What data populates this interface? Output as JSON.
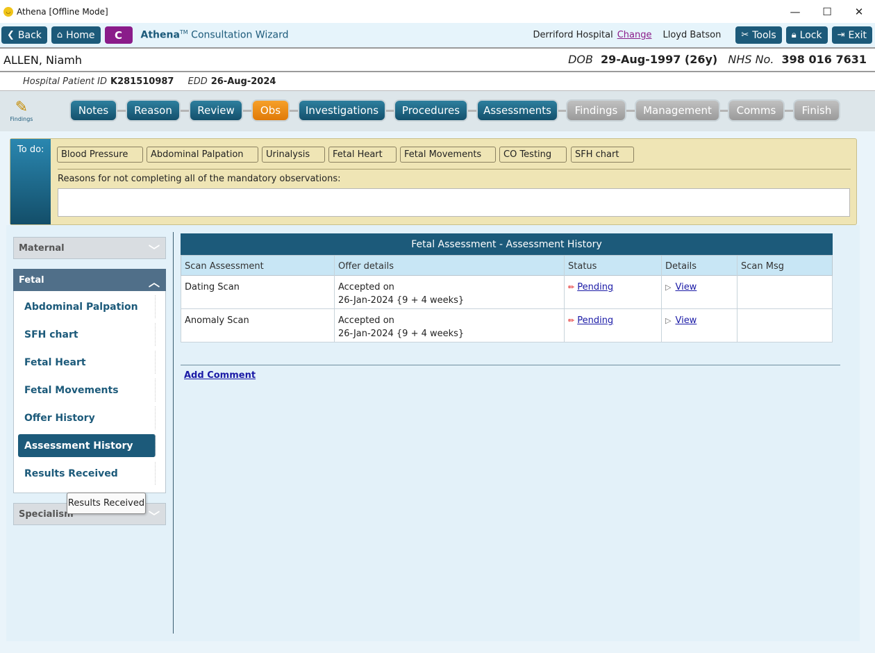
{
  "window": {
    "title": "Athena [Offline Mode]",
    "minimize": "—",
    "maximize": "☐",
    "close": "✕"
  },
  "toolbar": {
    "back": "Back",
    "home": "Home",
    "c_label": "C",
    "brand_name": "Athena",
    "brand_tm": "TM",
    "brand_rest": "Consultation Wizard",
    "hospital": "Derriford Hospital",
    "change": "Change",
    "user": "Lloyd Batson",
    "tools": "Tools",
    "lock": "Lock",
    "exit": "Exit"
  },
  "patient": {
    "name": "ALLEN, Niamh",
    "dob_label": "DOB",
    "dob": "29-Aug-1997 (26y)",
    "nhs_label": "NHS No.",
    "nhs": "398 016 7631",
    "hospital_id_label": "Hospital Patient ID",
    "hospital_id": "K281510987",
    "edd_label": "EDD",
    "edd": "26-Aug-2024"
  },
  "wizard": {
    "icon_label": "Findings",
    "steps": [
      "Notes",
      "Reason",
      "Review",
      "Obs",
      "Investigations",
      "Procedures",
      "Assessments",
      "Findings",
      "Management",
      "Comms",
      "Finish"
    ]
  },
  "todo": {
    "label": "To do:",
    "chips": [
      "Blood Pressure",
      "Abdominal Palpation",
      "Urinalysis",
      "Fetal Heart",
      "Fetal Movements",
      "CO Testing",
      "SFH chart"
    ],
    "reason_label": "Reasons for not completing all of the mandatory observations:",
    "reason_value": ""
  },
  "left_panel": {
    "maternal": "Maternal",
    "fetal": "Fetal",
    "specialism": "Specialism",
    "fetal_items": [
      "Abdominal Palpation",
      "SFH chart",
      "Fetal Heart",
      "Fetal Movements",
      "Offer History",
      "Assessment History",
      "Results Received"
    ],
    "selected": "Assessment History",
    "tooltip": "Results Received"
  },
  "table": {
    "title": "Fetal Assessment - Assessment History",
    "headers": [
      "Scan Assessment",
      "Offer details",
      "Status",
      "Details",
      "Scan Msg"
    ],
    "rows": [
      {
        "scan": "Dating Scan",
        "offer_line1": "Accepted on",
        "offer_line2": "26-Jan-2024 {9 + 4 weeks}",
        "status": "Pending",
        "details": "View",
        "msg": ""
      },
      {
        "scan": "Anomaly Scan",
        "offer_line1": "Accepted on",
        "offer_line2": "26-Jan-2024 {9 + 4 weeks}",
        "status": "Pending",
        "details": "View",
        "msg": ""
      }
    ],
    "add_comment": "Add Comment"
  }
}
